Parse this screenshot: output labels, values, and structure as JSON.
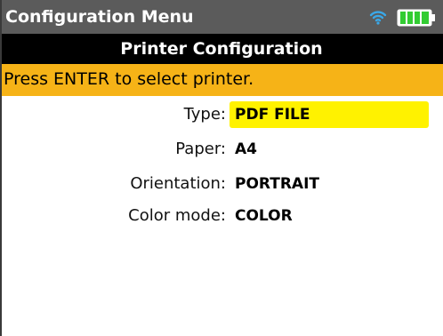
{
  "header": {
    "title": "Configuration Menu",
    "wifi_icon": "wifi-icon",
    "battery_icon": "battery-icon",
    "battery_level": 1.0,
    "accent_color": "#3aa8e8",
    "battery_color": "#33cc33"
  },
  "screen": {
    "title": "Printer Configuration",
    "instruction": "Press ENTER to select printer.",
    "instruction_color": "#f6b317",
    "highlight_color": "#fff200"
  },
  "settings": [
    {
      "label": "Type:",
      "value": "PDF FILE",
      "selected": true
    },
    {
      "label": "Paper:",
      "value": "A4",
      "selected": false
    },
    {
      "label": "Orientation:",
      "value": "PORTRAIT",
      "selected": false
    },
    {
      "label": "Color mode:",
      "value": "COLOR",
      "selected": false
    }
  ]
}
